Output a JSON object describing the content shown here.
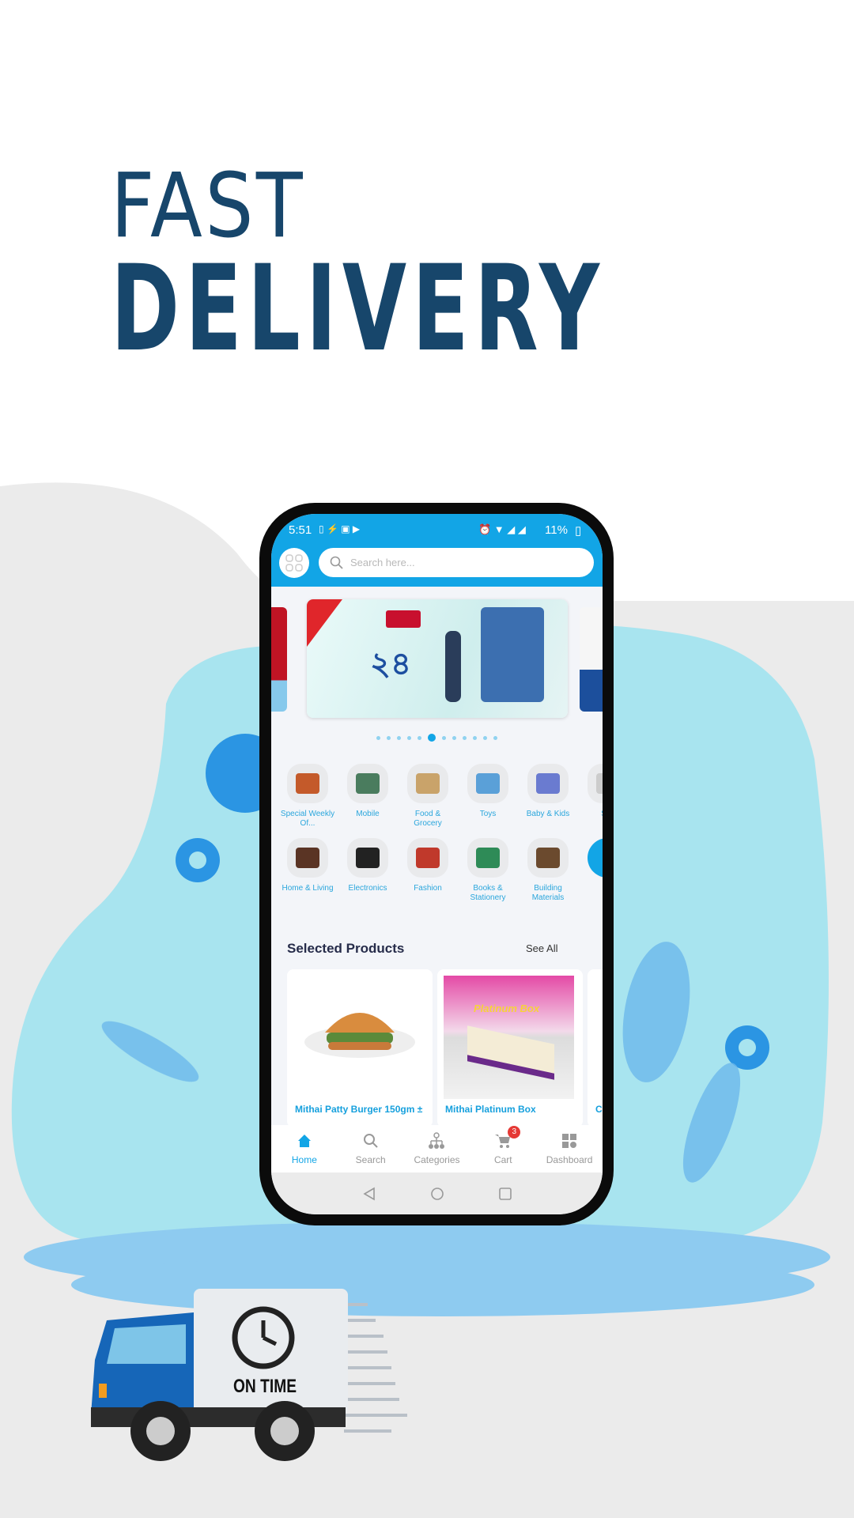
{
  "headline": {
    "line1": "FAST",
    "line2": "DELIVERY"
  },
  "colors": {
    "headline": "#17466b",
    "accent": "#12a5e6",
    "background_blob": "#a8e4ef",
    "floor": "#8ecbf0"
  },
  "status_bar": {
    "time": "5:51",
    "battery": "11%"
  },
  "search": {
    "placeholder": "Search here..."
  },
  "carousel": {
    "count": 12,
    "active_index": 5
  },
  "categories": [
    {
      "label": "Special Weekly Of...",
      "color": "#c45a2a"
    },
    {
      "label": "Mobile",
      "color": "#4a7c5e"
    },
    {
      "label": "Food & Grocery",
      "color": "#c9a36a"
    },
    {
      "label": "Toys",
      "color": "#5aa0d8"
    },
    {
      "label": "Baby & Kids",
      "color": "#6a7bd0"
    },
    {
      "label": "S Fi",
      "color": "#cccccc"
    },
    {
      "label": "Home & Living",
      "color": "#5a3424"
    },
    {
      "label": "Electronics",
      "color": "#222222"
    },
    {
      "label": "Fashion",
      "color": "#c0392b"
    },
    {
      "label": "Books & Stationery",
      "color": "#2e8b57"
    },
    {
      "label": "Building Materials",
      "color": "#6b4a2e"
    },
    {
      "label": "",
      "color": "#12a5e6"
    }
  ],
  "section": {
    "title": "Selected Products",
    "see_all": "See All"
  },
  "products": [
    {
      "name": "Mithai Patty Burger 150gm ±"
    },
    {
      "name": "Mithai Platinum Box",
      "image_text": "Platinum Box"
    },
    {
      "name": "C"
    }
  ],
  "bottom_nav": [
    {
      "label": "Home",
      "icon": "home-icon",
      "active": true
    },
    {
      "label": "Search",
      "icon": "search-icon"
    },
    {
      "label": "Categories",
      "icon": "hierarchy-icon"
    },
    {
      "label": "Cart",
      "icon": "cart-icon",
      "badge": "3"
    },
    {
      "label": "Dashboard",
      "icon": "dashboard-icon"
    }
  ],
  "truck": {
    "label": "ON TIME"
  }
}
